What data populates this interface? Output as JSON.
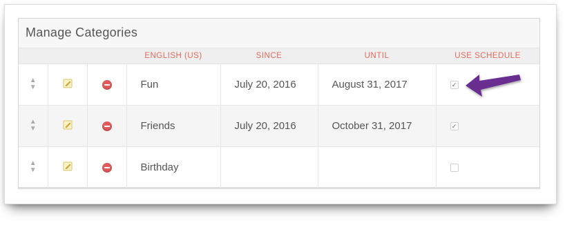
{
  "panel": {
    "title": "Manage Categories"
  },
  "table": {
    "headers": [
      "",
      "",
      "",
      "ENGLISH (US)",
      "SINCE",
      "UNTIL",
      "USE SCHEDULE"
    ],
    "rows": [
      {
        "name": "Fun",
        "since": "July 20, 2016",
        "until": "August 31, 2017",
        "use_schedule": "✓"
      },
      {
        "name": "Friends",
        "since": "July 20, 2016",
        "until": "October 31, 2017",
        "use_schedule": "✓"
      },
      {
        "name": "Birthday",
        "since": "",
        "until": "",
        "use_schedule": ""
      }
    ]
  },
  "icons": {
    "sort": "sort-icon",
    "edit": "pencil-icon",
    "delete": "minus-circle-icon",
    "annotation": "arrow-icon"
  },
  "colors": {
    "header_text": "#e36a5c",
    "delete": "#e05c5c",
    "arrow": "#6b2d91",
    "pencil": "#f5d24a"
  }
}
